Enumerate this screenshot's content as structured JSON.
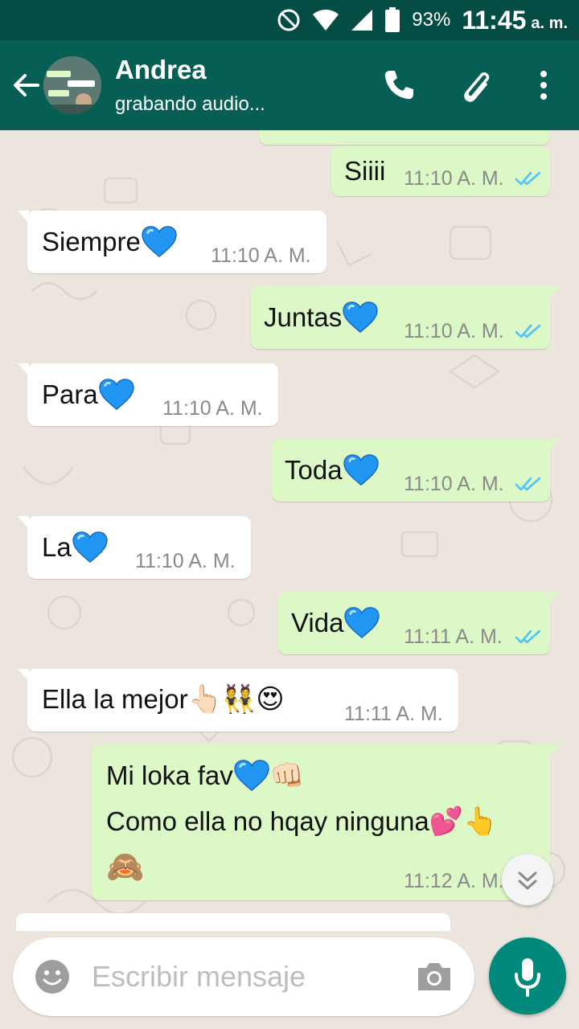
{
  "status_bar": {
    "battery_pct": "93%",
    "time": "11:45",
    "ampm": "a. m."
  },
  "header": {
    "contact_name": "Andrea",
    "contact_status": "grabando audio..."
  },
  "messages": [
    {
      "direction": "out",
      "text": "Siiii",
      "time": "11:10 A. M."
    },
    {
      "direction": "in",
      "text": "Siempre",
      "emoji": "blue-heart",
      "time": "11:10 A. M."
    },
    {
      "direction": "out",
      "text": "Juntas",
      "emoji": "blue-heart",
      "time": "11:10 A. M."
    },
    {
      "direction": "in",
      "text": "Para",
      "emoji": "blue-heart",
      "time": "11:10 A. M."
    },
    {
      "direction": "out",
      "text": "Toda",
      "emoji": "blue-heart",
      "time": "11:10 A. M."
    },
    {
      "direction": "in",
      "text": "La",
      "emoji": "blue-heart",
      "time": "11:10 A. M."
    },
    {
      "direction": "out",
      "text": "Vida",
      "emoji": "blue-heart",
      "time": "11:11 A. M."
    },
    {
      "direction": "in",
      "text": "Ella la mejor",
      "emoji": "👆🏻👯😍",
      "time": "11:11 A. M."
    },
    {
      "direction": "out",
      "line1": "Mi loka fav",
      "line1_emoji": "👊🏻",
      "line2": "Como ella no hqay ninguna",
      "line2_emoji": "💕👆",
      "line3_emoji": "🙈",
      "time": "11:12 A. M."
    }
  ],
  "composer": {
    "placeholder": "Escribir mensaje"
  },
  "colors": {
    "header": "#075e54",
    "status_bar": "#054d44",
    "outgoing": "#dcf8c6",
    "incoming": "#ffffff",
    "accent": "#00897b",
    "read_ticks": "#4fc3f7",
    "heart": "#2196f3"
  },
  "icons": [
    "back-arrow-icon",
    "phone-icon",
    "paperclip-icon",
    "more-vert-icon",
    "do-not-disturb-icon",
    "wifi-icon",
    "signal-icon",
    "battery-icon",
    "double-check-icon",
    "blue-heart-icon",
    "chevrons-down-icon",
    "smiley-icon",
    "camera-icon",
    "microphone-icon"
  ]
}
